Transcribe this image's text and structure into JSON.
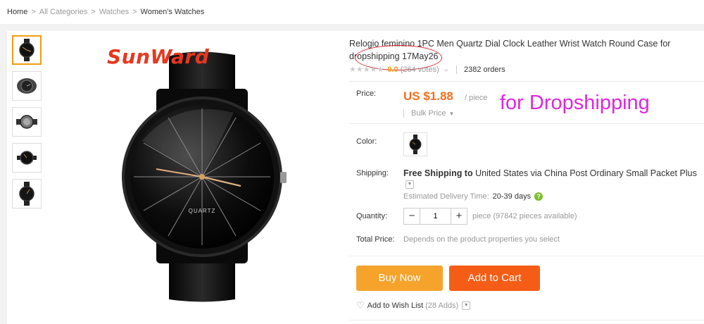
{
  "breadcrumb": {
    "items": [
      "Home",
      "All Categories",
      "Watches",
      "Women's Watches"
    ],
    "separator": ">"
  },
  "brand": {
    "logo_text": "SunWard"
  },
  "thumbnails": [
    {
      "alt": "watch-front-thumb"
    },
    {
      "alt": "watch-side-thumb"
    },
    {
      "alt": "watch-back-thumb"
    },
    {
      "alt": "watch-wrist-thumb"
    },
    {
      "alt": "watch-angle-thumb"
    }
  ],
  "product": {
    "title": "Relogio feminino 1PC Men Quartz Dial Clock Leather Wrist Watch Round Case for dropshipping 17May26",
    "rating": {
      "stars_icon": "star-icon",
      "score": "0.0",
      "votes": "(264 votes)",
      "orders_count": "2382",
      "orders_label": "orders"
    },
    "price": {
      "label": "Price:",
      "value": "US $1.88",
      "unit": "/ piece",
      "bulk_label": "Bulk Price",
      "annotation": "for Dropshipping"
    },
    "color": {
      "label": "Color:"
    },
    "shipping": {
      "label": "Shipping:",
      "strong": "Free Shipping to",
      "text": "United States via China Post Ordinary Small Packet Plus",
      "delivery_label": "Estimated Delivery Time:",
      "delivery_days": "20-39 days"
    },
    "quantity": {
      "label": "Quantity:",
      "value": "1",
      "minus": "−",
      "plus": "+",
      "available": "piece (97842 pieces available)"
    },
    "total": {
      "label": "Total Price:",
      "text": "Depends on the product properties you select"
    },
    "actions": {
      "buy_now": "Buy Now",
      "add_to_cart": "Add to Cart",
      "wishlist": "Add to Wish List",
      "wishlist_count": "(28 Adds)"
    }
  },
  "colors": {
    "accent_orange": "#f6a32c",
    "cart_orange": "#f55d17",
    "price_orange": "#f76e1a",
    "annotation_magenta": "#e026e0",
    "brand_red": "#e8371e"
  }
}
